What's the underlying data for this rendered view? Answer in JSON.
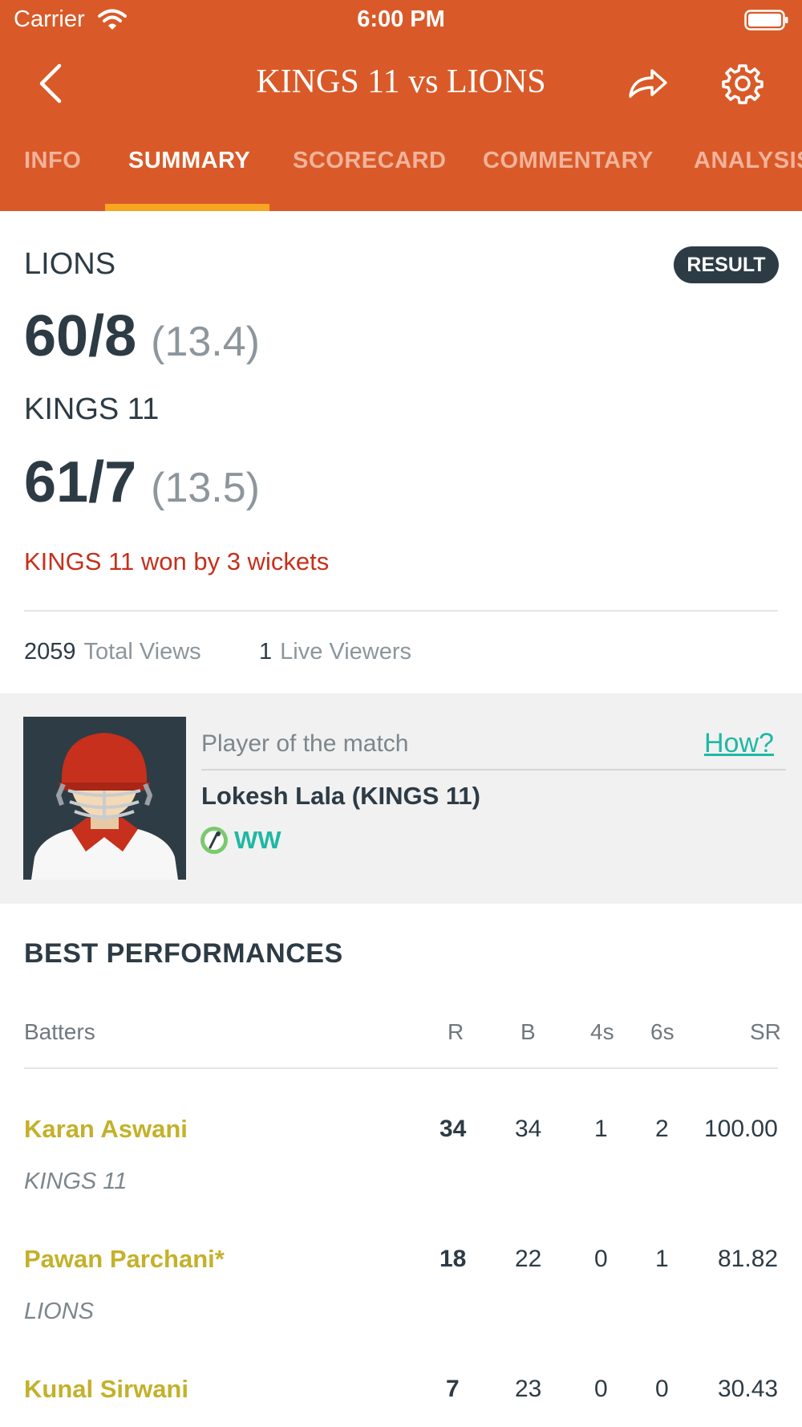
{
  "status_bar": {
    "carrier": "Carrier",
    "time": "6:00 PM"
  },
  "header": {
    "title": "KINGS 11 vs LIONS"
  },
  "tabs": [
    {
      "label": "INFO"
    },
    {
      "label": "SUMMARY"
    },
    {
      "label": "SCORECARD"
    },
    {
      "label": "COMMENTARY"
    },
    {
      "label": "ANALYSIS"
    }
  ],
  "active_tab": "SUMMARY",
  "summary": {
    "badge": "RESULT",
    "innings": [
      {
        "team": "LIONS",
        "score": "60/8",
        "overs": "(13.4)"
      },
      {
        "team": "KINGS 11",
        "score": "61/7",
        "overs": "(13.5)"
      }
    ],
    "result": "KINGS 11 won by 3 wickets",
    "total_views": {
      "count": "2059",
      "label": "Total Views"
    },
    "live_viewers": {
      "count": "1",
      "label": "Live Viewers"
    }
  },
  "player_of_match": {
    "label": "Player of the match",
    "how": "How?",
    "name": "Lokesh Lala (KINGS 11)",
    "role": "WW"
  },
  "best_performances": {
    "title": "BEST PERFORMANCES",
    "columns": [
      "Batters",
      "R",
      "B",
      "4s",
      "6s",
      "SR"
    ],
    "rows": [
      {
        "name": "Karan Aswani",
        "team": "KINGS 11",
        "r": "34",
        "b": "34",
        "fours": "1",
        "sixes": "2",
        "sr": "100.00"
      },
      {
        "name": "Pawan Parchani*",
        "team": "LIONS",
        "r": "18",
        "b": "22",
        "fours": "0",
        "sixes": "1",
        "sr": "81.82"
      },
      {
        "name": "Kunal Sirwani",
        "team": "",
        "r": "7",
        "b": "23",
        "fours": "0",
        "sixes": "0",
        "sr": "30.43"
      }
    ]
  },
  "colors": {
    "brand": "#d95a28",
    "tab_indicator": "#f6a623",
    "result_text": "#c6301c",
    "link": "#1fb8a3",
    "player_name": "#c3b12b",
    "dark": "#2d3b45"
  }
}
